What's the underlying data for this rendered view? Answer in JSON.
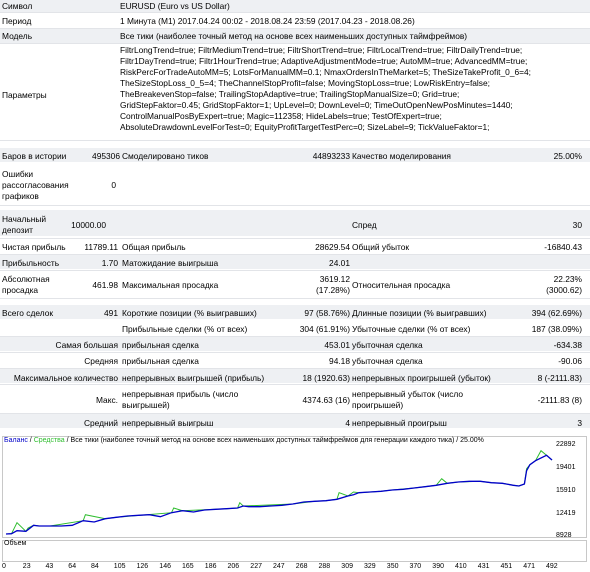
{
  "colors": {
    "balance": "#0000c8",
    "equity": "#2ebd2e",
    "volume": "#2ebd2e",
    "label_green": "#008000"
  },
  "report": {
    "symbol_label": "Символ",
    "symbol_value": "EURUSD (Euro vs US Dollar)",
    "period_label": "Период",
    "period_value": "1 Минута (M1) 2017.04.24 00:02 - 2018.08.24 23:59 (2017.04.23 - 2018.08.26)",
    "model_label": "Модель",
    "model_value": "Все тики (наиболее точный метод на основе всех наименьших доступных таймфреймов)",
    "params_label": "Параметры",
    "params_lines": [
      "FiltrLongTrend=true; FiltrMediumTrend=true; FiltrShortTrend=true; FiltrLocalTrend=true; FiltrDailyTrend=true;",
      "Filtr1DayTrend=true; Filtr1HourTrend=true; AdaptiveAdjustmentMode=true; AutoMM=true; AdvancedMM=true;",
      "RiskPercForTradeAutoMM=5; LotsForManualMM=0.1; NmaxOrdersInTheMarket=5; TheSizeTakeProfit_0_6=4;",
      "TheSizeStopLoss_0_5=4; TheChannelStopProfit=false; MovingStopLoss=true; LowRiskEntry=false;",
      "TheBreakevenStop=false; TrailingStopAdaptive=true; TrailingStopManualSize=0; Grid=true;",
      "GridStepFaktor=0.45; GridStopFaktor=1; UpLevel=0; DownLevel=0; TimeOutOpenNewPosMinutes=1440;",
      "ControlManualPosByExpert=true; Magic=112358; HideLabels=true; TestOfExpert=true;",
      "AbsoluteDrawdownLevelForTest=0; EquityProfitTargetTestPerc=0; SizeLabel=9; TickValueFaktor=1;"
    ],
    "bars_label": "Баров в истории",
    "bars_value": "495306",
    "ticks_label": "Смоделировано тиков",
    "ticks_value": "44893233",
    "quality_label": "Качество моделирования",
    "quality_value": "25.00%",
    "errors_label_1": "Ошибки",
    "errors_label_2": "рассогласования",
    "errors_label_3": "графиков",
    "errors_value": "0",
    "deposit_label_1": "Начальный",
    "deposit_label_2": "депозит",
    "deposit_value": "10000.00",
    "spread_label": "Спред",
    "spread_value": "30",
    "net_label": "Чистая прибыль",
    "net_value": "11789.11",
    "gross_profit_label": "Общая прибыль",
    "gross_profit_value": "28629.54",
    "gross_loss_label": "Общий убыток",
    "gross_loss_value": "-16840.43",
    "pf_label": "Прибыльность",
    "pf_value": "1.70",
    "expected_label": "Матожидание выигрыша",
    "expected_value": "24.01",
    "abs_dd_label_1": "Абсолютная",
    "abs_dd_label_2": "просадка",
    "abs_dd_value": "461.98",
    "max_dd_label": "Максимальная просадка",
    "max_dd_value_1": "3619.12",
    "max_dd_value_2": "(17.28%)",
    "rel_dd_label": "Относительная просадка",
    "rel_dd_value_1": "22.23%",
    "rel_dd_value_2": "(3000.62)",
    "total_trades_label": "Всего сделок",
    "total_trades_value": "491",
    "short_label": "Короткие позиции (% выигравших)",
    "short_value": "97 (58.76%)",
    "long_label": "Длинные позиции (% выигравших)",
    "long_value": "394 (62.69%)",
    "profit_trades_label": "Прибыльные сделки (% от всех)",
    "profit_trades_value": "304 (61.91%)",
    "loss_trades_label": "Убыточные сделки (% от всех)",
    "loss_trades_value": "187 (38.09%)",
    "largest_label": "Самая большая",
    "largest_profit_label": "прибыльная сделка",
    "largest_profit_value": "453.01",
    "largest_loss_label": "убыточная сделка",
    "largest_loss_value": "-634.38",
    "average_label": "Средняя",
    "avg_profit_label": "прибыльная сделка",
    "avg_profit_value": "94.18",
    "avg_loss_label": "убыточная сделка",
    "avg_loss_value": "-90.06",
    "maxcount_label": "Максимальное количество",
    "cons_wins_label": "непрерывных выигрышей (прибыль)",
    "cons_wins_value": "18 (1920.63)",
    "cons_losses_label": "непрерывных проигрышей (убыток)",
    "cons_losses_value": "8 (-2111.83)",
    "max_label": "Макс.",
    "cons_profit_label_1": "непрерывная прибыль (число",
    "cons_profit_label_2": "выигрышей)",
    "cons_profit_value": "4374.63 (16)",
    "cons_loss_label_1": "непрерывный убыток (число",
    "cons_loss_label_2": "проигрышей)",
    "cons_loss_value": "-2111.83 (8)",
    "avg_cons_label": "Средний",
    "avg_cons_wins_label": "непрерывный выигрыш",
    "avg_cons_wins_value": "4",
    "avg_cons_losses_label": "непрерывный проигрыш",
    "avg_cons_losses_value": "3"
  },
  "chart_data": {
    "type": "line",
    "legend_balance": "Баланс",
    "legend_sep": " / ",
    "legend_equity": "Средства",
    "legend_rest": " / Все тики (наиболее точный метод на основе всех наименьших доступных таймфреймов для генерации каждого тика) / 25.00%",
    "volume_label": "Объем",
    "ylim": [
      10000,
      23800
    ],
    "yticks": [
      "22892",
      "19401",
      "15910",
      "12419",
      "8928"
    ],
    "xticks": [
      "0",
      "23",
      "43",
      "64",
      "84",
      "105",
      "126",
      "146",
      "165",
      "186",
      "206",
      "227",
      "247",
      "268",
      "288",
      "309",
      "329",
      "350",
      "370",
      "390",
      "410",
      "431",
      "451",
      "471",
      "492"
    ],
    "xlim": [
      0,
      495
    ],
    "series": [
      {
        "name": "Баланс",
        "x": [
          0,
          5,
          10,
          18,
          25,
          30,
          40,
          50,
          60,
          70,
          80,
          90,
          100,
          110,
          120,
          130,
          140,
          150,
          160,
          170,
          180,
          190,
          200,
          210,
          215,
          220,
          230,
          240,
          250,
          260,
          270,
          280,
          290,
          300,
          310,
          315,
          320,
          330,
          340,
          350,
          360,
          370,
          380,
          390,
          400,
          410,
          420,
          430,
          440,
          450,
          460,
          465,
          470,
          472,
          475,
          480,
          490,
          495
        ],
        "y": [
          10000,
          10050,
          10500,
          10400,
          11300,
          11200,
          11200,
          11200,
          11300,
          12000,
          11800,
          12300,
          12500,
          12700,
          12800,
          12900,
          12600,
          13200,
          13500,
          13300,
          13600,
          13700,
          13800,
          13900,
          14200,
          14100,
          14100,
          14200,
          14300,
          14500,
          14800,
          14900,
          15000,
          15200,
          15700,
          15900,
          16200,
          16300,
          16400,
          16600,
          16700,
          16900,
          17100,
          17300,
          17600,
          17800,
          17900,
          17900,
          17700,
          17600,
          17300,
          17200,
          17500,
          19500,
          20400,
          21000,
          21800,
          21100
        ]
      },
      {
        "name": "Средства",
        "x": [
          0,
          5,
          10,
          18,
          20,
          25,
          30,
          40,
          70,
          72,
          90,
          100,
          150,
          152,
          160,
          200,
          210,
          212,
          215,
          260,
          280,
          290,
          300,
          302,
          310,
          315,
          320,
          330,
          340,
          350,
          370,
          390,
          395,
          400,
          410,
          430,
          440,
          450,
          460,
          465,
          470,
          472,
          475,
          480,
          485,
          490,
          495
        ],
        "y": [
          10000,
          10050,
          11700,
          10400,
          10900,
          11300,
          11200,
          11200,
          12000,
          12900,
          12300,
          12500,
          13200,
          13900,
          13500,
          13800,
          13900,
          14700,
          14200,
          14500,
          14900,
          15000,
          15200,
          16200,
          15700,
          16300,
          16200,
          16300,
          16400,
          16600,
          16900,
          17300,
          18300,
          17600,
          17800,
          17900,
          17700,
          17600,
          17300,
          17200,
          17500,
          19800,
          20400,
          21000,
          22500,
          21800,
          21100
        ]
      }
    ],
    "volume_levels": [
      0.45,
      0.5,
      0.55,
      0.4,
      0.5,
      0.6,
      0.45,
      0.5,
      0.4,
      0.55,
      0.6,
      0.5,
      0.45,
      0.55,
      0.5,
      0.6,
      0.55,
      0.5,
      0.45,
      0.6,
      0.55,
      0.5,
      0.6,
      0.55,
      0.5,
      0.45,
      0.55,
      0.6,
      0.5,
      0.55,
      0.45,
      0.5,
      0.6,
      0.55,
      0.5,
      0.6,
      0.55,
      0.5,
      0.45,
      0.55,
      0.6,
      0.55,
      0.5,
      0.6,
      0.55,
      0.5,
      0.6,
      0.55,
      0.65,
      0.6,
      0.55,
      0.6,
      0.5,
      0.55,
      0.6,
      0.65,
      0.55,
      0.6,
      0.5,
      0.6
    ]
  }
}
